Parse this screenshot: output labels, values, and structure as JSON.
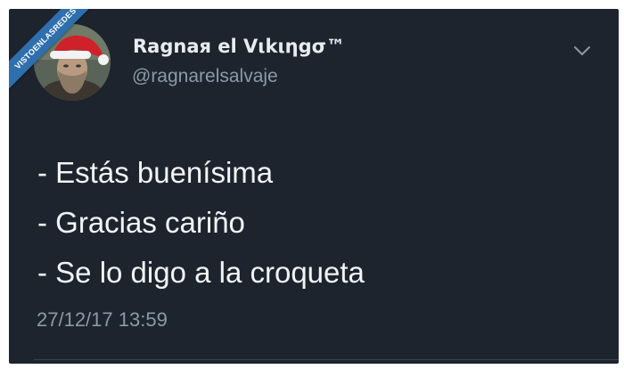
{
  "watermark": {
    "label": "VISTOENLASREDES"
  },
  "tweet": {
    "display_name": "Ragnaя el Vιkιηgσ™",
    "handle": "@ragnarelsalvaje",
    "lines": [
      "- Estás buenísima",
      "- Gracias cariño",
      "- Se lo digo a la croqueta"
    ],
    "timestamp": "27/12/17 13:59"
  },
  "icons": {
    "avatar": "profile-photo-santa-hat",
    "menu": "chevron-down-icon"
  },
  "colors": {
    "background": "#1d242e",
    "primary_text": "#f2f4f6",
    "secondary_text": "#8a9aa8",
    "ribbon": "#2e6fae"
  }
}
